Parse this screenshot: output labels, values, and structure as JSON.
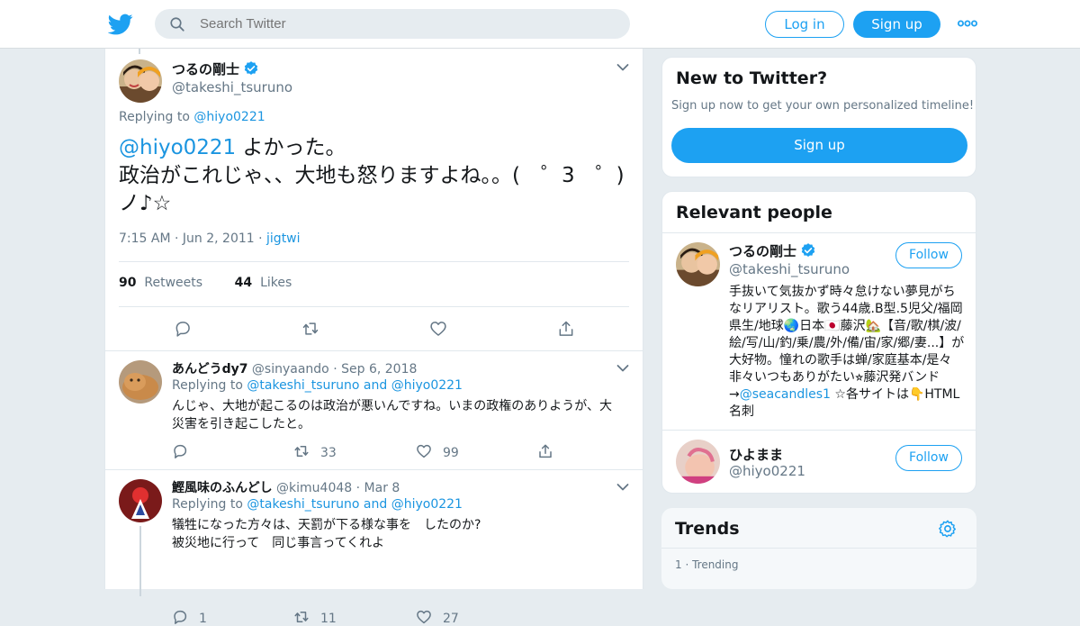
{
  "nav": {
    "search_placeholder": "Search Twitter",
    "login_label": "Log in",
    "signup_label": "Sign up",
    "brand_color": "#1da1f2"
  },
  "main_tweet": {
    "name": "つるの剛士",
    "handle": "@takeshi_tsuruno",
    "replying_prefix": "Replying to",
    "replying_to": "@hiyo0221",
    "mention": "@hiyo0221",
    "text_line1_rest": " よかった。",
    "text_line2": "政治がこれじゃ、、大地も怒りますよね。。(　゜3　゜)",
    "text_line3": "ノ♪☆",
    "time": "7:15 AM",
    "date": "Jun 2, 2011",
    "source": "jigtwi",
    "retweets_count": "90",
    "retweets_label": "Retweets",
    "likes_count": "44",
    "likes_label": "Likes"
  },
  "replies": [
    {
      "name": "あんどうdy7",
      "handle": "@sinyaando",
      "date": "Sep 6, 2018",
      "replying_prefix": "Replying to",
      "replying_to": "@takeshi_tsuruno and @hiyo0221",
      "text": "んじゃ、大地が起こるのは政治が悪いんですね。いまの政権のありようが、大災害を引き起こしたと。",
      "retweets": "33",
      "likes": "99"
    },
    {
      "name": "鰹風味のふんどし",
      "handle": "@kimu4048",
      "date": "Mar 8",
      "replying_prefix": "Replying to",
      "replying_to": "@takeshi_tsuruno and @hiyo0221",
      "text_line1": "犠牲になった方々は、天罰が下る様な事を　したのか?",
      "text_line2": "被災地に行って　同じ事言ってくれよ",
      "replies_count": "1",
      "retweets": "11",
      "likes": "27"
    }
  ],
  "sidebar": {
    "new_title": "New to Twitter?",
    "new_subtitle": "Sign up now to get your own personalized timeline!",
    "new_button": "Sign up",
    "relevant_title": "Relevant people",
    "people": [
      {
        "name": "つるの剛士",
        "handle": "@takeshi_tsuruno",
        "follow_label": "Follow",
        "bio_part1": "手抜いて気抜かず時々怠けない夢見がちなリアリスト。歌う44歳.B型.5児父/福岡県生/地球🌏日本🇯🇵藤沢🏡【音/歌/棋/波/絵/写/山/釣/乗/農/外/備/宙/家/郷/妻...】が大好物。憧れの歌手は蝉/家庭基本/是々非々いつもありがたい⭐︎藤沢発バンド→",
        "bio_link": "@seacandles1",
        "bio_part2": " ☆各サイトは👇HTML名刺"
      },
      {
        "name": "ひよまま",
        "handle": "@hiyo0221",
        "follow_label": "Follow"
      }
    ],
    "trends_title": "Trends",
    "trend_first_meta": "1 · Trending"
  }
}
